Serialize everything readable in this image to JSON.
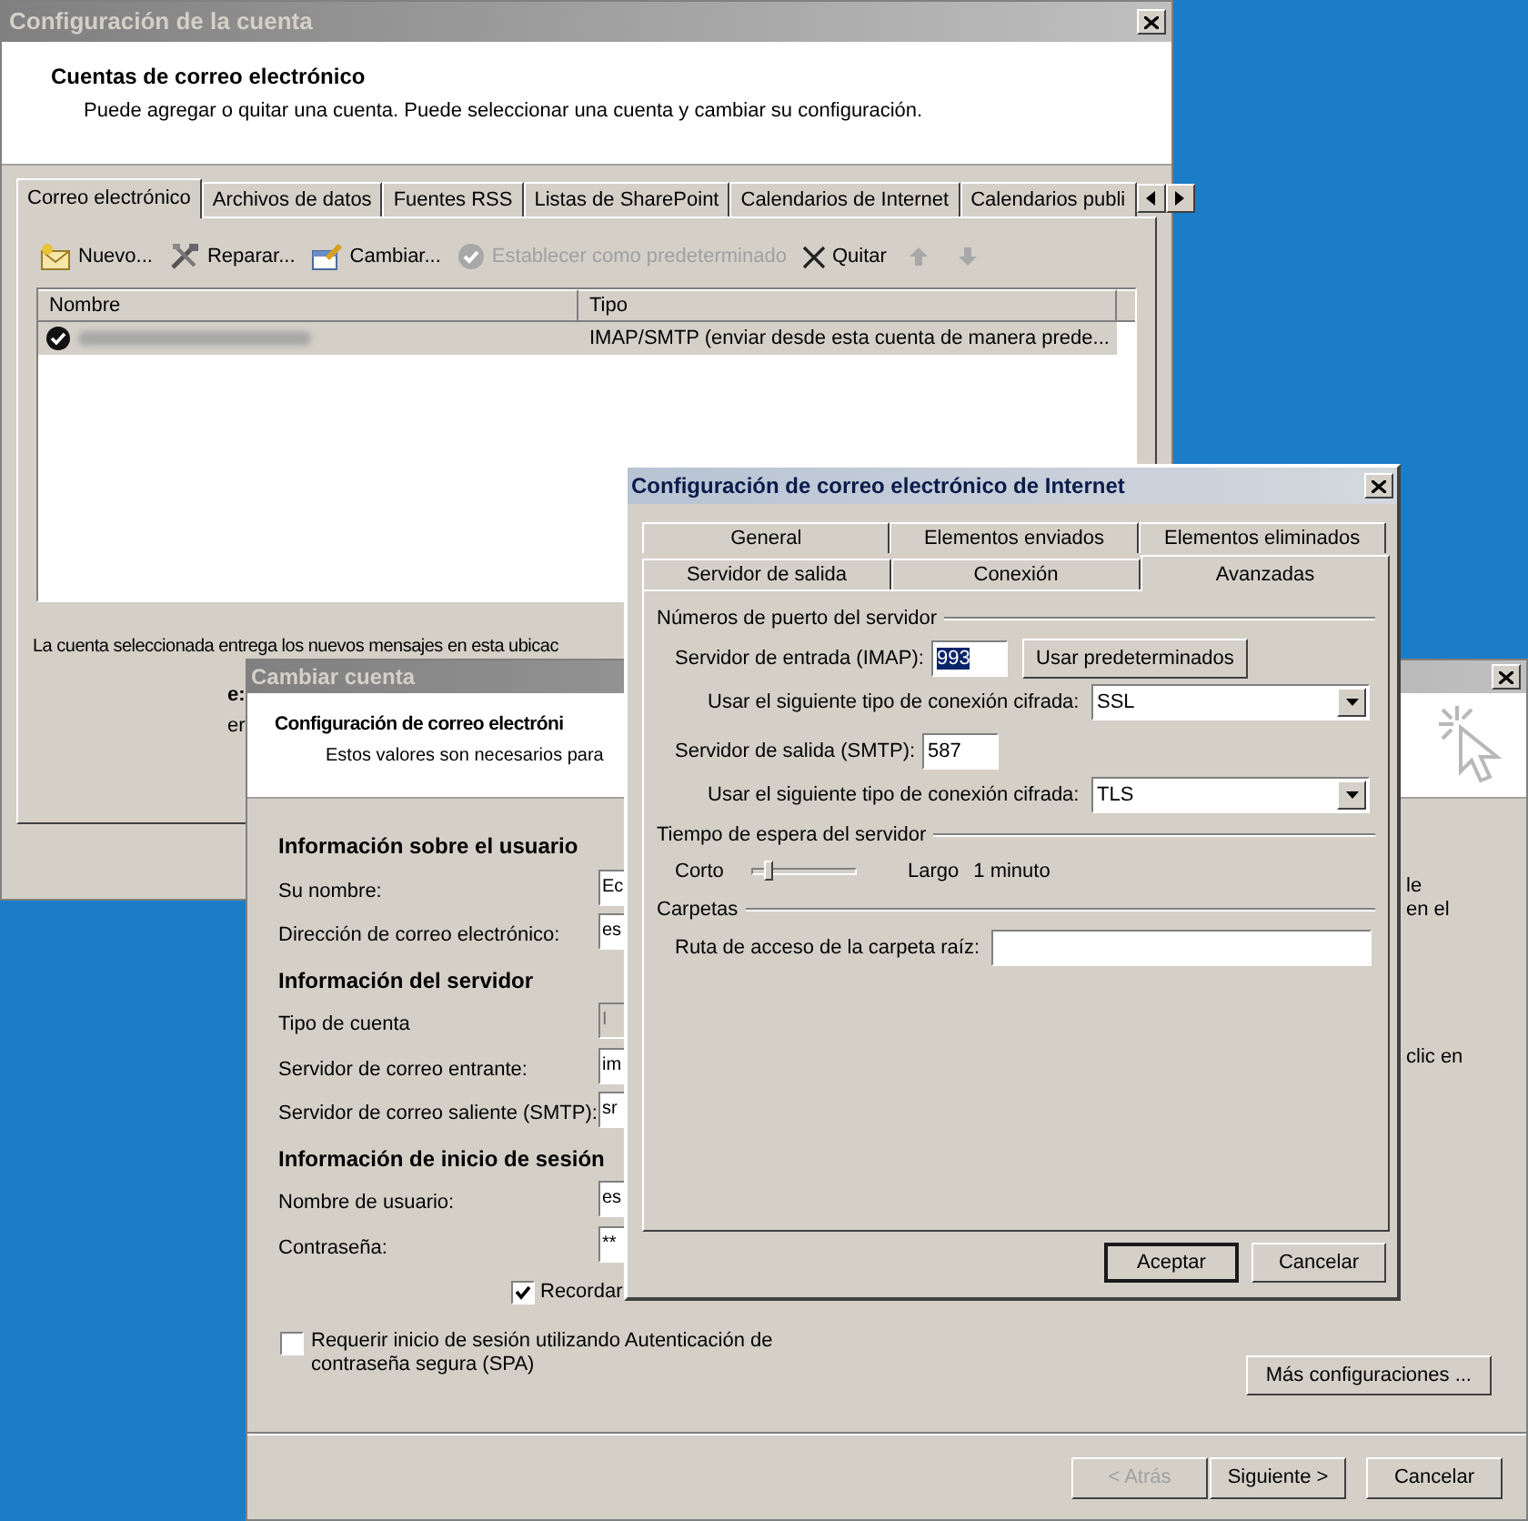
{
  "account_settings": {
    "title": "Configuración de la cuenta",
    "heading": "Cuentas de correo electrónico",
    "description": "Puede agregar o quitar una cuenta. Puede seleccionar una cuenta y cambiar su configuración.",
    "tabs": [
      {
        "label": "Correo electrónico",
        "selected": true
      },
      {
        "label": "Archivos de datos",
        "selected": false
      },
      {
        "label": "Fuentes RSS",
        "selected": false
      },
      {
        "label": "Listas de SharePoint",
        "selected": false
      },
      {
        "label": "Calendarios de Internet",
        "selected": false
      },
      {
        "label": "Calendarios publi",
        "selected": false
      }
    ],
    "toolbar": [
      {
        "kind": "new",
        "label": "Nuevo...",
        "disabled": false
      },
      {
        "kind": "repair",
        "label": "Reparar...",
        "disabled": false
      },
      {
        "kind": "change",
        "label": "Cambiar...",
        "disabled": false
      },
      {
        "kind": "default",
        "label": "Establecer como predeterminado",
        "disabled": true
      },
      {
        "kind": "remove",
        "label": "Quitar",
        "disabled": false
      },
      {
        "kind": "up",
        "disabled": true
      },
      {
        "kind": "down",
        "disabled": true
      }
    ],
    "columns": [
      "Nombre",
      "Tipo"
    ],
    "rows": [
      {
        "default": true,
        "selected": true,
        "type": "IMAP/SMTP (enviar desde esta cuenta de manera prede..."
      }
    ],
    "delivery_text": "La cuenta seleccionada entrega los nuevos mensajes en esta ubicac",
    "fragments": [
      {
        "text": "e:",
        "bold": true
      },
      {
        "text": "er",
        "bold": false
      }
    ]
  },
  "change_account": {
    "title": "Cambiar cuenta",
    "heading": "Configuración de correo electróni",
    "description": "Estos valores son necesarios para",
    "sections": [
      {
        "title": "Información sobre el usuario",
        "fields": [
          {
            "label": "Su nombre:",
            "value": "Ec",
            "disabled": false
          },
          {
            "label": "Dirección de correo electrónico:",
            "value": "es",
            "disabled": false
          }
        ]
      },
      {
        "title": "Información del servidor",
        "fields": [
          {
            "label": "Tipo de cuenta",
            "value": "I",
            "disabled": true
          },
          {
            "label": "Servidor de correo entrante:",
            "value": "im",
            "disabled": false
          },
          {
            "label": "Servidor de correo saliente (SMTP):",
            "value": "sr",
            "disabled": false
          }
        ]
      },
      {
        "title": "Información de inicio de sesión",
        "fields": [
          {
            "label": "Nombre de usuario:",
            "value": "es",
            "disabled": false
          },
          {
            "label": "Contraseña:",
            "value": "**",
            "disabled": false
          }
        ]
      }
    ],
    "remember": {
      "label": "Recordar",
      "checked": true
    },
    "spa": {
      "label": "Requerir inicio de sesión utilizando Autenticación de contraseña segura (SPA)",
      "checked": false
    },
    "side_text": [
      [
        "le",
        "en el"
      ],
      [
        "clic en"
      ]
    ],
    "more_button": "Más configuraciones ...",
    "buttons": [
      {
        "label": "< Atrás",
        "disabled": true
      },
      {
        "label": "Siguiente >",
        "disabled": false
      },
      {
        "label": "Cancelar",
        "disabled": false
      }
    ]
  },
  "internet_settings": {
    "title": "Configuración de correo electrónico de Internet",
    "tab_rows": [
      [
        {
          "label": "General",
          "selected": false
        },
        {
          "label": "Elementos enviados",
          "selected": false
        },
        {
          "label": "Elementos eliminados",
          "selected": false
        }
      ],
      [
        {
          "label": "Servidor de salida",
          "selected": false
        },
        {
          "label": "Conexión",
          "selected": false
        },
        {
          "label": "Avanzadas",
          "selected": true
        }
      ]
    ],
    "groups": [
      {
        "title": "Números de puerto del servidor",
        "rows": [
          {
            "kind": "port",
            "label": "Servidor de entrada (IMAP):",
            "value": "993",
            "value_selected": true,
            "button": "Usar predeterminados"
          },
          {
            "kind": "select",
            "label": "Usar el siguiente tipo de conexión cifrada:",
            "value": "SSL"
          },
          {
            "kind": "port",
            "label": "Servidor de salida (SMTP):",
            "value": "587",
            "value_selected": false
          },
          {
            "kind": "select",
            "label": "Usar el siguiente tipo de conexión cifrada:",
            "value": "TLS"
          }
        ]
      },
      {
        "title": "Tiempo de espera del servidor",
        "rows": [
          {
            "kind": "slider",
            "min_label": "Corto",
            "max_label": "Largo",
            "level": 0.1,
            "reading": "1 minuto"
          }
        ]
      },
      {
        "title": "Carpetas",
        "rows": [
          {
            "kind": "path",
            "label": "Ruta de acceso de la carpeta raíz:"
          }
        ]
      }
    ],
    "buttons": [
      {
        "label": "Aceptar",
        "default": true
      },
      {
        "label": "Cancelar",
        "default": false
      }
    ]
  }
}
